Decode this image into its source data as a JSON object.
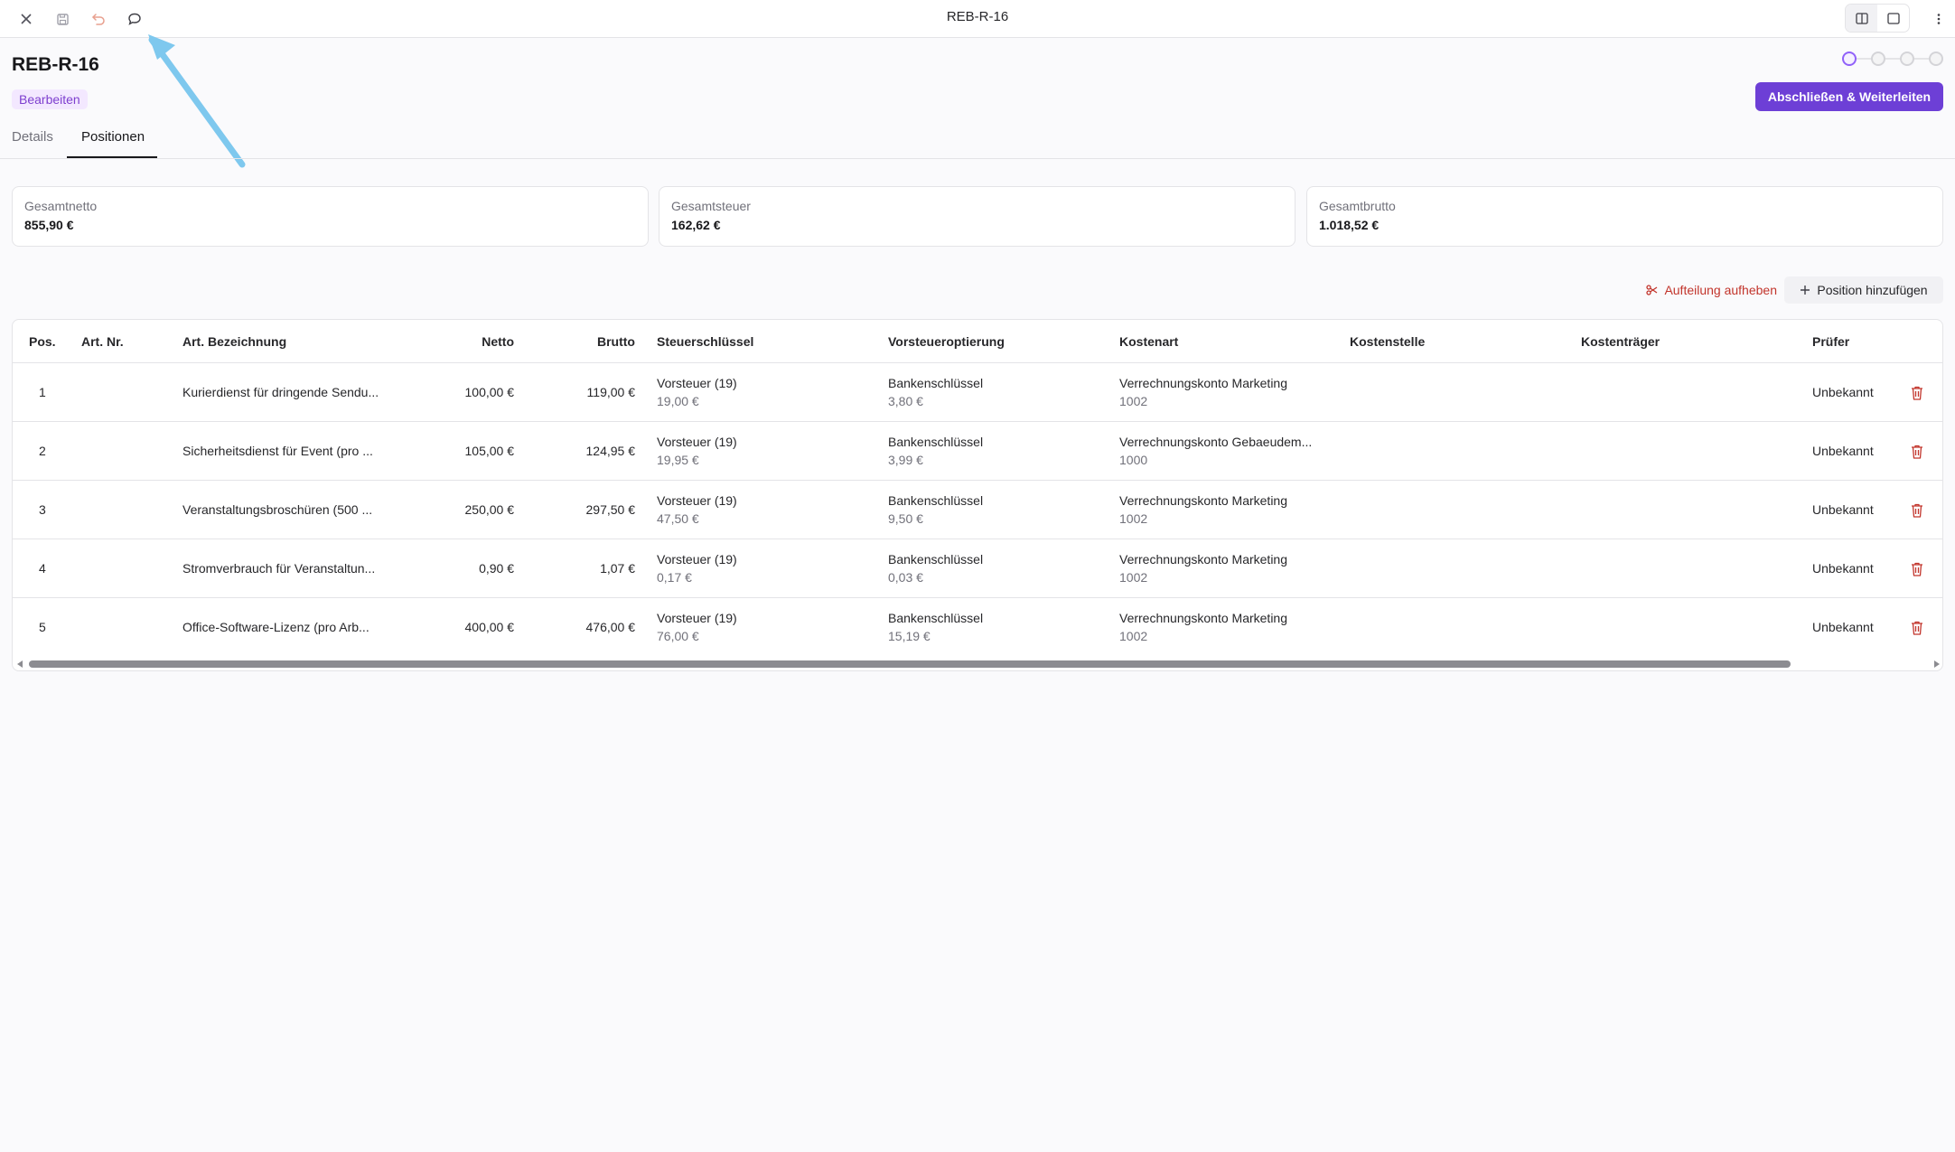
{
  "window": {
    "title": "REB-R-16"
  },
  "header": {
    "title": "REB-R-16",
    "status_badge": "Bearbeiten",
    "primary_action": "Abschließen & Weiterleiten"
  },
  "tabs": [
    {
      "label": "Details",
      "active": false
    },
    {
      "label": "Positionen",
      "active": true
    }
  ],
  "summary": [
    {
      "label": "Gesamtnetto",
      "value": "855,90 €"
    },
    {
      "label": "Gesamtsteuer",
      "value": "162,62 €"
    },
    {
      "label": "Gesamtbrutto",
      "value": "1.018,52 €"
    }
  ],
  "actions": {
    "split_remove": "Aufteilung aufheben",
    "add_position": "Position hinzufügen"
  },
  "table": {
    "columns": [
      "Pos.",
      "Art. Nr.",
      "Art. Bezeichnung",
      "Netto",
      "Brutto",
      "Steuerschlüssel",
      "Vorsteueroptierung",
      "Kostenart",
      "Kostenstelle",
      "Kostenträger",
      "Prüfer"
    ],
    "rows": [
      {
        "pos": "1",
        "art_nr": "",
        "bezeichnung": "Kurierdienst für dringende Sendu...",
        "netto": "100,00 €",
        "brutto": "119,00 €",
        "steuer": "Vorsteuer (19)",
        "steuer_betrag": "19,00 €",
        "vorsteuer": "Bankenschlüssel",
        "vorsteuer_betrag": "3,80 €",
        "kostenart": "Verrechnungskonto Marketing",
        "kostenart_nr": "1002",
        "pruefer": "Unbekannt"
      },
      {
        "pos": "2",
        "art_nr": "",
        "bezeichnung": "Sicherheitsdienst für Event (pro ...",
        "netto": "105,00 €",
        "brutto": "124,95 €",
        "steuer": "Vorsteuer (19)",
        "steuer_betrag": "19,95 €",
        "vorsteuer": "Bankenschlüssel",
        "vorsteuer_betrag": "3,99 €",
        "kostenart": "Verrechnungskonto Gebaeudem...",
        "kostenart_nr": "1000",
        "pruefer": "Unbekannt"
      },
      {
        "pos": "3",
        "art_nr": "",
        "bezeichnung": "Veranstaltungsbroschüren (500 ...",
        "netto": "250,00 €",
        "brutto": "297,50 €",
        "steuer": "Vorsteuer (19)",
        "steuer_betrag": "47,50 €",
        "vorsteuer": "Bankenschlüssel",
        "vorsteuer_betrag": "9,50 €",
        "kostenart": "Verrechnungskonto Marketing",
        "kostenart_nr": "1002",
        "pruefer": "Unbekannt"
      },
      {
        "pos": "4",
        "art_nr": "",
        "bezeichnung": "Stromverbrauch für Veranstaltun...",
        "netto": "0,90 €",
        "brutto": "1,07 €",
        "steuer": "Vorsteuer (19)",
        "steuer_betrag": "0,17 €",
        "vorsteuer": "Bankenschlüssel",
        "vorsteuer_betrag": "0,03 €",
        "kostenart": "Verrechnungskonto Marketing",
        "kostenart_nr": "1002",
        "pruefer": "Unbekannt"
      },
      {
        "pos": "5",
        "art_nr": "",
        "bezeichnung": "Office-Software-Lizenz (pro Arb...",
        "netto": "400,00 €",
        "brutto": "476,00 €",
        "steuer": "Vorsteuer (19)",
        "steuer_betrag": "76,00 €",
        "vorsteuer": "Bankenschlüssel",
        "vorsteuer_betrag": "15,19 €",
        "kostenart": "Verrechnungskonto Marketing",
        "kostenart_nr": "1002",
        "pruefer": "Unbekannt"
      }
    ]
  },
  "stepper": {
    "steps": 4,
    "current": 1
  },
  "colors": {
    "accent": "#6d3fd6",
    "badge_bg": "#f3e8ff",
    "danger": "#c2342b",
    "annotation": "#7ec8ee"
  },
  "icons": [
    "close-icon",
    "save-icon",
    "undo-icon",
    "comment-icon",
    "split-view-icon",
    "single-view-icon",
    "more-icon",
    "scissors-icon",
    "plus-icon",
    "trash-icon"
  ]
}
